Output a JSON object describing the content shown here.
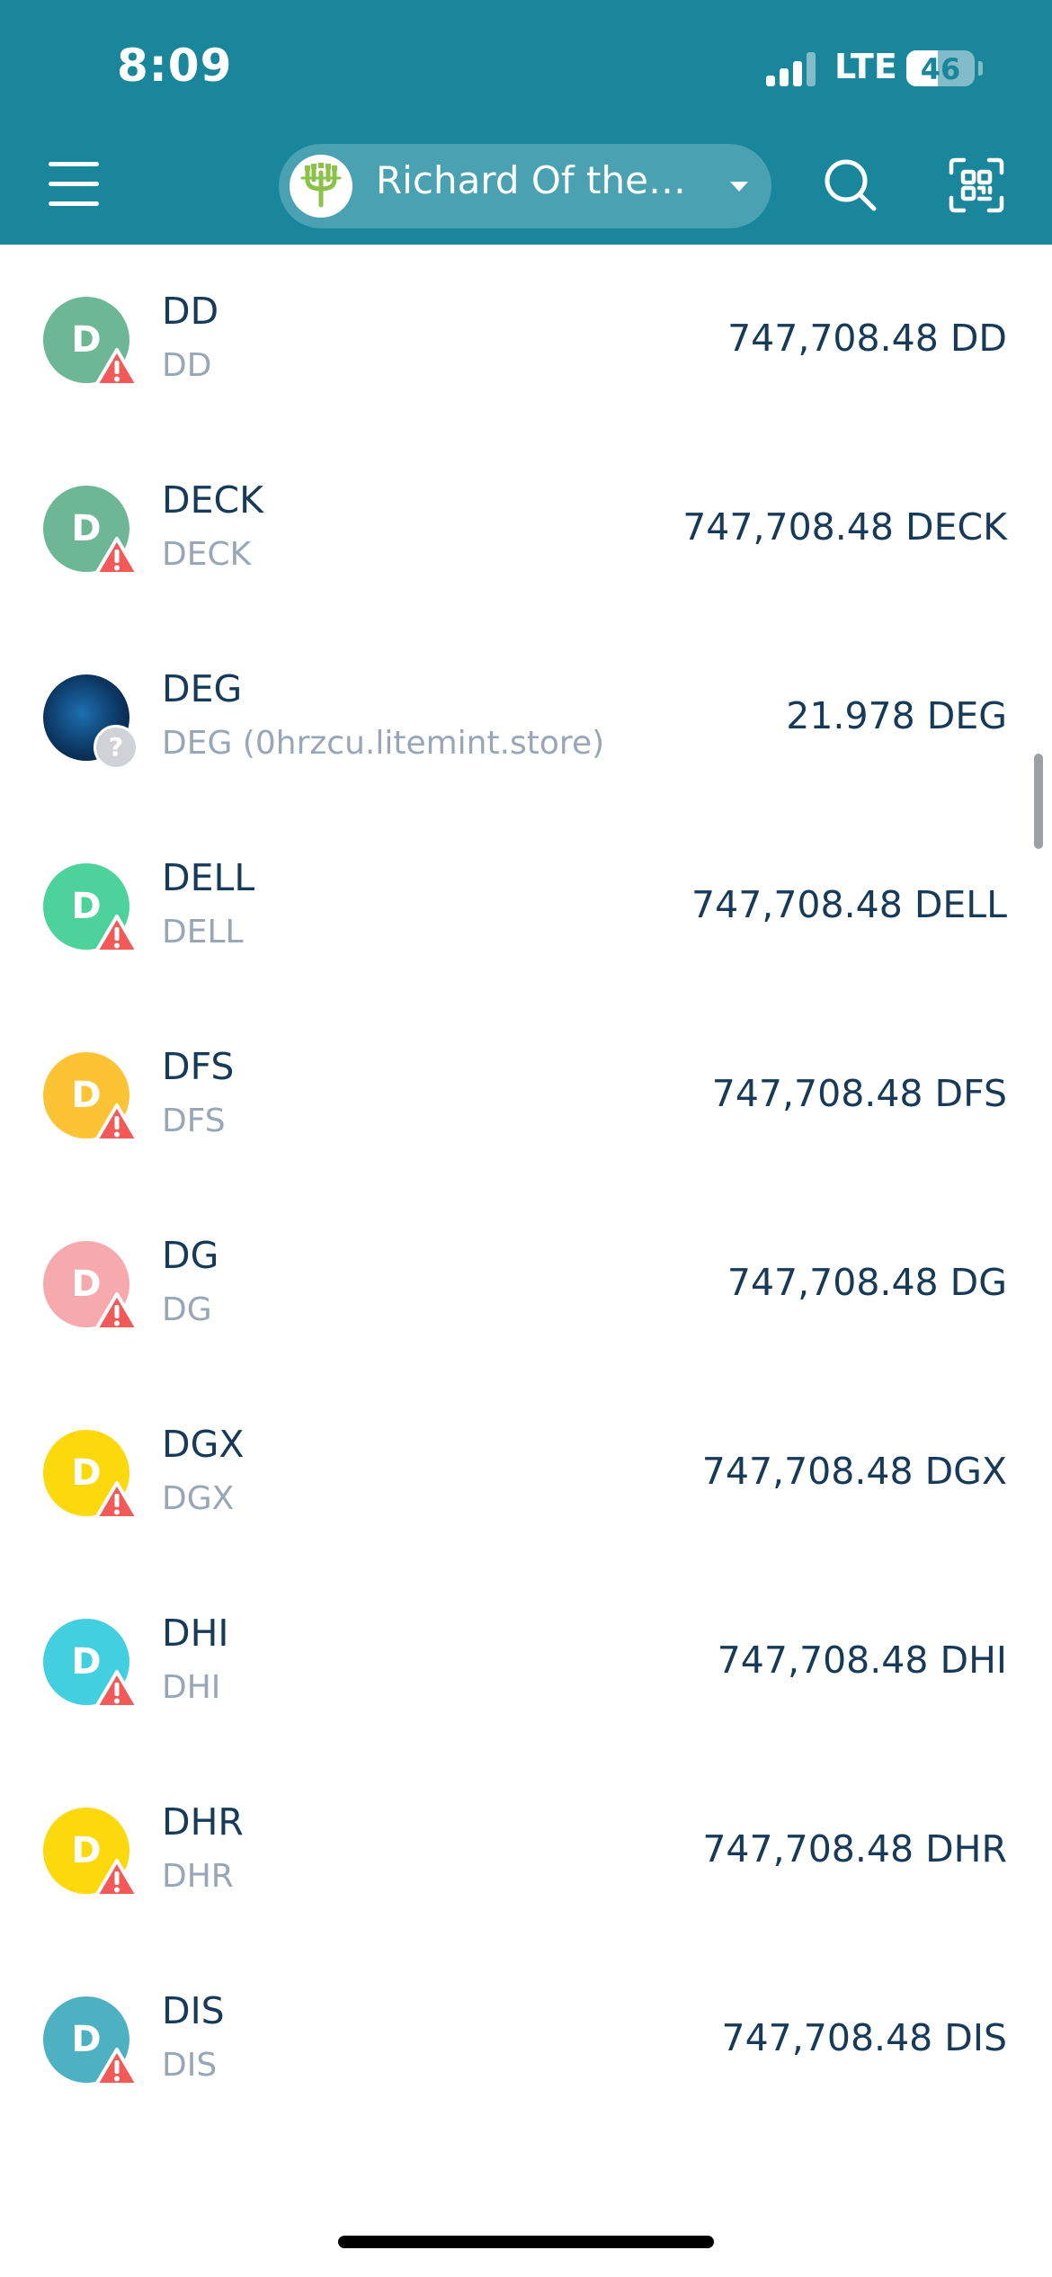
{
  "status_bar": {
    "time": "8:09",
    "network": "LTE",
    "battery_level": "46"
  },
  "header": {
    "wallet_name": "Richard Of the…",
    "menu_icon": "hamburger-menu-icon",
    "search_icon": "search-icon",
    "scan_icon": "qr-scan-icon"
  },
  "colors": {
    "header_bg": "#1a869b",
    "warning_red": "#f25a5a"
  },
  "tokens": [
    {
      "symbol": "DD",
      "name": "DD",
      "balance": "747,708.48 DD",
      "avatar_letter": "D",
      "avatar_color": "#6db796",
      "badge": "warning"
    },
    {
      "symbol": "DECK",
      "name": "DECK",
      "balance": "747,708.48 DECK",
      "avatar_letter": "D",
      "avatar_color": "#6db796",
      "badge": "warning"
    },
    {
      "symbol": "DEG",
      "name": "DEG (0hrzcu.litemint.store)",
      "balance": "21.978 DEG",
      "avatar_letter": "",
      "avatar_color": "#0c3763",
      "badge": "unknown"
    },
    {
      "symbol": "DELL",
      "name": "DELL",
      "balance": "747,708.48 DELL",
      "avatar_letter": "D",
      "avatar_color": "#4ed29b",
      "badge": "warning"
    },
    {
      "symbol": "DFS",
      "name": "DFS",
      "balance": "747,708.48 DFS",
      "avatar_letter": "D",
      "avatar_color": "#fcc435",
      "badge": "warning"
    },
    {
      "symbol": "DG",
      "name": "DG",
      "balance": "747,708.48 DG",
      "avatar_letter": "D",
      "avatar_color": "#f6aaad",
      "badge": "warning"
    },
    {
      "symbol": "DGX",
      "name": "DGX",
      "balance": "747,708.48 DGX",
      "avatar_letter": "D",
      "avatar_color": "#fcd90d",
      "badge": "warning"
    },
    {
      "symbol": "DHI",
      "name": "DHI",
      "balance": "747,708.48 DHI",
      "avatar_letter": "D",
      "avatar_color": "#42cfdf",
      "badge": "warning"
    },
    {
      "symbol": "DHR",
      "name": "DHR",
      "balance": "747,708.48 DHR",
      "avatar_letter": "D",
      "avatar_color": "#fcd90d",
      "badge": "warning"
    },
    {
      "symbol": "DIS",
      "name": "DIS",
      "balance": "747,708.48 DIS",
      "avatar_letter": "D",
      "avatar_color": "#4eb1c1",
      "badge": "warning"
    }
  ]
}
